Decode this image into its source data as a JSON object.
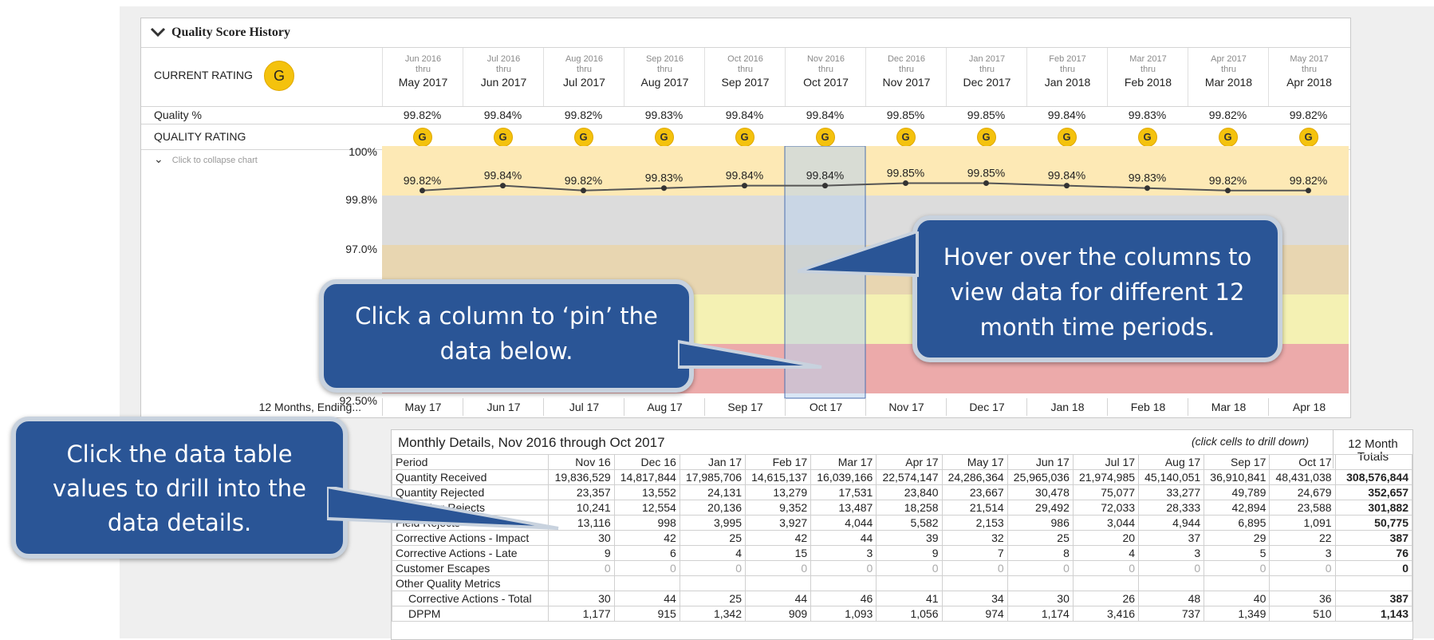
{
  "panel": {
    "title": "Quality Score History",
    "current_rating_label": "CURRENT RATING",
    "current_rating": "G",
    "quality_pct_label": "Quality %",
    "quality_rating_label": "QUALITY RATING",
    "collapse_chart": "Click to collapse chart",
    "periods": [
      {
        "start": "Jun 2016",
        "thru": "thru",
        "end": "May 2017",
        "pct": "99.82%",
        "rating": "G",
        "x_label": "May 17"
      },
      {
        "start": "Jul 2016",
        "thru": "thru",
        "end": "Jun 2017",
        "pct": "99.84%",
        "rating": "G",
        "x_label": "Jun 17"
      },
      {
        "start": "Aug 2016",
        "thru": "thru",
        "end": "Jul 2017",
        "pct": "99.82%",
        "rating": "G",
        "x_label": "Jul 17"
      },
      {
        "start": "Sep 2016",
        "thru": "thru",
        "end": "Aug 2017",
        "pct": "99.83%",
        "rating": "G",
        "x_label": "Aug 17"
      },
      {
        "start": "Oct 2016",
        "thru": "thru",
        "end": "Sep 2017",
        "pct": "99.84%",
        "rating": "G",
        "x_label": "Sep 17"
      },
      {
        "start": "Nov 2016",
        "thru": "thru",
        "end": "Oct 2017",
        "pct": "99.84%",
        "rating": "G",
        "x_label": "Oct 17"
      },
      {
        "start": "Dec 2016",
        "thru": "thru",
        "end": "Nov 2017",
        "pct": "99.85%",
        "rating": "G",
        "x_label": "Nov 17"
      },
      {
        "start": "Jan 2017",
        "thru": "thru",
        "end": "Dec 2017",
        "pct": "99.85%",
        "rating": "G",
        "x_label": "Dec 17"
      },
      {
        "start": "Feb 2017",
        "thru": "thru",
        "end": "Jan 2018",
        "pct": "99.84%",
        "rating": "G",
        "x_label": "Jan 18"
      },
      {
        "start": "Mar 2017",
        "thru": "thru",
        "end": "Feb 2018",
        "pct": "99.83%",
        "rating": "G",
        "x_label": "Feb 18"
      },
      {
        "start": "Apr 2017",
        "thru": "thru",
        "end": "Mar 2018",
        "pct": "99.82%",
        "rating": "G",
        "x_label": "Mar 18"
      },
      {
        "start": "May 2017",
        "thru": "thru",
        "end": "Apr 2018",
        "pct": "99.82%",
        "rating": "G",
        "x_label": "Apr 18"
      }
    ],
    "x_axis_title": "12 Months, Ending...",
    "selected_index": 5
  },
  "chart_data": {
    "type": "line",
    "categories": [
      "May 17",
      "Jun 17",
      "Jul 17",
      "Aug 17",
      "Sep 17",
      "Oct 17",
      "Nov 17",
      "Dec 17",
      "Jan 18",
      "Feb 18",
      "Mar 18",
      "Apr 18"
    ],
    "series": [
      {
        "values": [
          99.82,
          99.84,
          99.82,
          99.83,
          99.84,
          99.84,
          99.85,
          99.85,
          99.84,
          99.83,
          99.82,
          99.82
        ]
      }
    ],
    "data_labels": [
      "99.82%",
      "99.84%",
      "99.82%",
      "99.83%",
      "99.84%",
      "99.84%",
      "99.85%",
      "99.85%",
      "99.84%",
      "99.83%",
      "99.82%",
      "99.82%"
    ],
    "y_ticks": [
      "100%",
      "99.8%",
      "97.0%",
      "92.50%"
    ],
    "xlabel": "12 Months, Ending...",
    "bands": [
      {
        "color": "#fde9b5"
      },
      {
        "color": "#dcdcdc"
      },
      {
        "color": "#e8d6b1"
      },
      {
        "color": "#f4f1b3"
      },
      {
        "color": "#ecaaaa"
      }
    ],
    "line_color": "#555555",
    "selected_color": "#b9d1ec"
  },
  "callouts": {
    "hover": "Hover over the columns to view data for different 12 month time periods.",
    "pin": "Click a column to ‘pin’ the data below.",
    "drill": "Click the data table values to drill into the data details."
  },
  "details": {
    "title": "Monthly Details, Nov 2016 through Oct 2017",
    "hint": "(click cells to drill down)",
    "totals_header": "12 Month Totals",
    "period_label": "Period",
    "months": [
      "Nov 16",
      "Dec 16",
      "Jan 17",
      "Feb 17",
      "Mar 17",
      "Apr 17",
      "May 17",
      "Jun 17",
      "Jul 17",
      "Aug 17",
      "Sep 17",
      "Oct 17"
    ],
    "rows": [
      {
        "label": "Quantity Received",
        "values": [
          "19,836,529",
          "14,817,844",
          "17,985,706",
          "14,615,137",
          "16,039,166",
          "22,574,147",
          "24,286,364",
          "25,965,036",
          "21,974,985",
          "45,140,051",
          "36,910,841",
          "48,431,038"
        ],
        "total": "308,576,844"
      },
      {
        "label": "Quantity Rejected",
        "values": [
          "23,357",
          "13,552",
          "24,131",
          "13,279",
          "17,531",
          "23,840",
          "23,667",
          "30,478",
          "75,077",
          "33,277",
          "49,789",
          "24,679"
        ],
        "total": "352,657"
      },
      {
        "label": "Receiving Rejects",
        "values": [
          "10,241",
          "12,554",
          "20,136",
          "9,352",
          "13,487",
          "18,258",
          "21,514",
          "29,492",
          "72,033",
          "28,333",
          "42,894",
          "23,588"
        ],
        "total": "301,882"
      },
      {
        "label": "Field Rejects",
        "values": [
          "13,116",
          "998",
          "3,995",
          "3,927",
          "4,044",
          "5,582",
          "2,153",
          "986",
          "3,044",
          "4,944",
          "6,895",
          "1,091"
        ],
        "total": "50,775"
      },
      {
        "label": "Corrective Actions - Impact",
        "values": [
          "30",
          "42",
          "25",
          "42",
          "44",
          "39",
          "32",
          "25",
          "20",
          "37",
          "29",
          "22"
        ],
        "total": "387"
      },
      {
        "label": "Corrective Actions - Late",
        "values": [
          "9",
          "6",
          "4",
          "15",
          "3",
          "9",
          "7",
          "8",
          "4",
          "3",
          "5",
          "3"
        ],
        "total": "76"
      },
      {
        "label": "Customer Escapes",
        "values": [
          "0",
          "0",
          "0",
          "0",
          "0",
          "0",
          "0",
          "0",
          "0",
          "0",
          "0",
          "0"
        ],
        "total": "0",
        "muted": true
      },
      {
        "label": "Other Quality Metrics",
        "values": [
          "",
          "",
          "",
          "",
          "",
          "",
          "",
          "",
          "",
          "",
          "",
          ""
        ],
        "total": ""
      },
      {
        "label": "Corrective Actions - Total",
        "values": [
          "30",
          "44",
          "25",
          "44",
          "46",
          "41",
          "34",
          "30",
          "26",
          "48",
          "40",
          "36"
        ],
        "total": "387",
        "indent": true
      },
      {
        "label": "DPPM",
        "values": [
          "1,177",
          "915",
          "1,342",
          "909",
          "1,093",
          "1,056",
          "974",
          "1,174",
          "3,416",
          "737",
          "1,349",
          "510"
        ],
        "total": "1,143",
        "indent": true
      }
    ]
  }
}
